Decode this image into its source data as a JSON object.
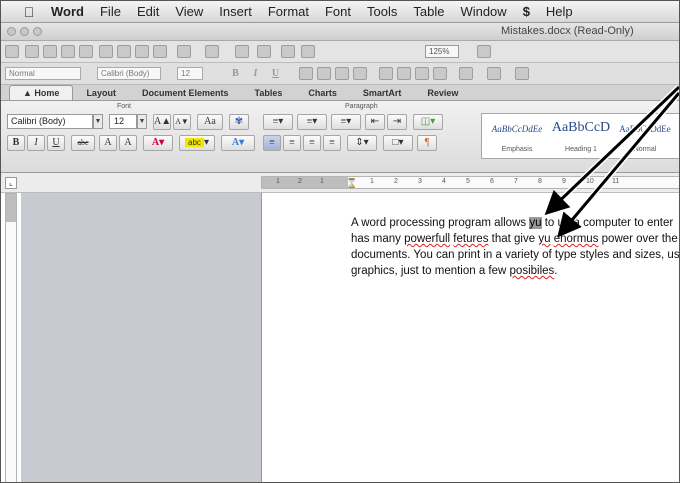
{
  "menubar": {
    "app_name": "Word",
    "items": [
      "File",
      "Edit",
      "View",
      "Insert",
      "Format",
      "Font",
      "Tools",
      "Table",
      "Window",
      "Help"
    ]
  },
  "window": {
    "title": "Mistakes.docx (Read-Only)"
  },
  "toolbar": {
    "zoom": "125%"
  },
  "format_bar": {
    "style": "Normal",
    "font": "Calibri (Body)",
    "size": "12"
  },
  "ribbon": {
    "tabs": [
      "Home",
      "Layout",
      "Document Elements",
      "Tables",
      "Charts",
      "SmartArt",
      "Review"
    ],
    "active_tab": "Home",
    "group_font_label": "Font",
    "group_paragraph_label": "Paragraph",
    "font_name": "Calibri (Body)",
    "font_size": "12",
    "grow_font": "A",
    "shrink_font": "A",
    "bold": "B",
    "italic": "I",
    "underline": "U",
    "strikethrough": "abc",
    "superscript": "A",
    "subscript": "A",
    "styles": [
      {
        "preview": "AaBbCcDdEe",
        "name": "Emphasis"
      },
      {
        "preview": "AaBbCcD",
        "name": "Heading 1"
      },
      {
        "preview": "AaBbCcDdEe",
        "name": "Normal"
      }
    ]
  },
  "ruler": {
    "ticks": [
      "1",
      "2",
      "1",
      "1",
      "2",
      "3",
      "4",
      "5",
      "6",
      "7",
      "8",
      "9",
      "10",
      "11"
    ]
  },
  "document": {
    "line1": {
      "a": "A word processing program allows ",
      "sel": "yu",
      "b": " to ",
      "c": "u",
      "d": "e a computer to enter"
    },
    "line2": {
      "a": "has many ",
      "err1": "powerfull",
      "b": " ",
      "err2": "fetures",
      "c": " that give ",
      "err3": "yu",
      "d": " ",
      "err4": "enormus",
      "e": " power over the"
    },
    "line3": "documents.  You can print in a variety of type styles and sizes, use",
    "line4": {
      "a": "graphics, just to mention a few ",
      "err": "posibiles",
      "b": "."
    }
  },
  "colors": {
    "error_underline": "#d22",
    "selection": "#9a9a9a",
    "workspace": "#c7cbd1"
  }
}
